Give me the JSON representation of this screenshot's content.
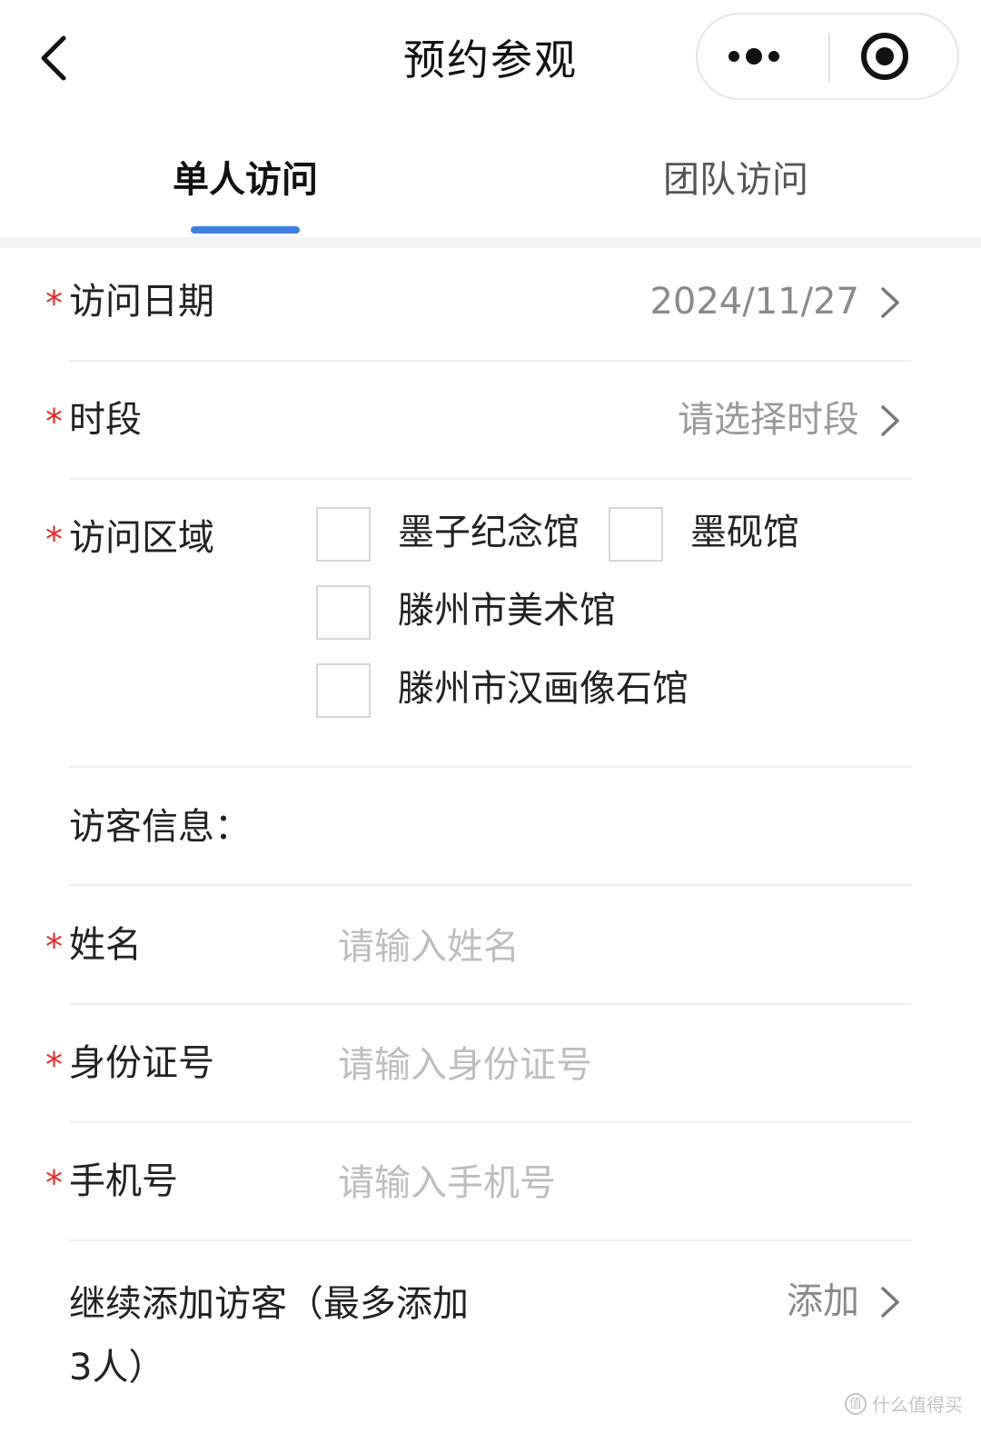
{
  "header": {
    "title": "预约参观"
  },
  "tabs": [
    {
      "label": "单人访问",
      "active": true
    },
    {
      "label": "团队访问",
      "active": false
    }
  ],
  "colors": {
    "accent": "#3f7fe0",
    "required": "#e02b2b"
  },
  "form": {
    "required_mark": "*",
    "date": {
      "label": "访问日期",
      "value": "2024/11/27"
    },
    "time_slot": {
      "label": "时段",
      "value": "请选择时段"
    },
    "area": {
      "label": "访问区域",
      "options": [
        {
          "label": "墨子纪念馆",
          "checked": false
        },
        {
          "label": "墨砚馆",
          "checked": false
        },
        {
          "label": "滕州市美术馆",
          "checked": false
        },
        {
          "label": "滕州市汉画像石馆",
          "checked": false
        }
      ]
    },
    "visitor_section_title": "访客信息：",
    "name": {
      "label": "姓名",
      "placeholder": "请输入姓名"
    },
    "id_number": {
      "label": "身份证号",
      "placeholder": "请输入身份证号"
    },
    "phone": {
      "label": "手机号",
      "placeholder": "请输入手机号"
    },
    "add_visitor": {
      "label": "继续添加访客（最多添加3人）",
      "action": "添加"
    }
  },
  "watermark": {
    "icon": "值",
    "text": "什么值得买"
  }
}
